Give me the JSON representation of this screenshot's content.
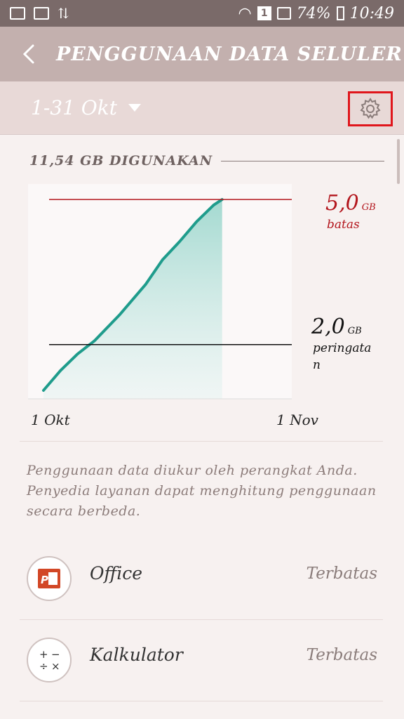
{
  "status_bar": {
    "battery": "74%",
    "time": "10:49",
    "sim": "1",
    "icons": [
      "gallery-icon",
      "news-icon",
      "sync-icon",
      "wifi-icon",
      "sim-icon",
      "signal-icon",
      "battery-icon"
    ]
  },
  "app_bar": {
    "title": "PENGGUNAAN DATA SELULER",
    "back_icon": "back-arrow-icon"
  },
  "period": {
    "label": "1-31 Okt",
    "settings_icon": "gear-icon",
    "highlight_color": "#e0161c"
  },
  "usage": {
    "label": "11,54 GB DIGUNAKAN"
  },
  "chart_data": {
    "type": "area",
    "x_start_label": "1 Okt",
    "x_end_label": "1 Nov",
    "y_unit": "GB",
    "series": [
      {
        "x": [
          1,
          3,
          5,
          7,
          10,
          13,
          15,
          17,
          19,
          21,
          22
        ],
        "values": [
          0.0,
          1.2,
          2.2,
          3.0,
          4.6,
          6.4,
          7.9,
          9.0,
          10.2,
          11.2,
          11.54
        ]
      }
    ],
    "limit": {
      "value": "5,0",
      "unit": "GB",
      "label": "batas",
      "color": "#b3161d"
    },
    "warning": {
      "value": "2,0",
      "unit": "GB",
      "label": "peringatan",
      "color": "#111111"
    },
    "line_color": "#1f9c8c",
    "fill_color": "#bfe6e0"
  },
  "note": "Penggunaan data diukur oleh perangkat Anda. Penyedia layanan dapat menghitung penggunaan secara berbeda.",
  "apps": [
    {
      "name": "Office",
      "status": "Terbatas",
      "icon": "powerpoint-icon"
    },
    {
      "name": "Kalkulator",
      "status": "Terbatas",
      "icon": "calculator-icon"
    }
  ]
}
